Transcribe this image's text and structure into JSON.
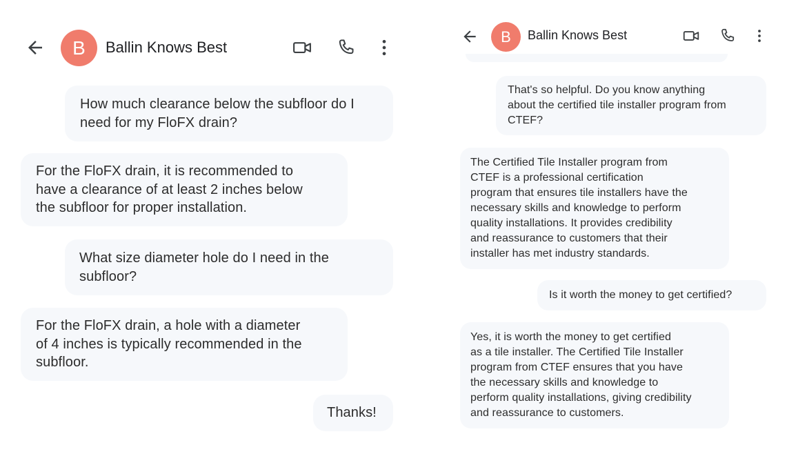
{
  "colors": {
    "avatar_bg": "#f07c6c",
    "bubble_bg": "#f6f8fb",
    "icon": "#3c4043"
  },
  "icons": {
    "back": "arrow-left-icon",
    "video": "video-camera-icon",
    "phone": "phone-icon",
    "more": "more-vertical-icon"
  },
  "left_screen": {
    "header": {
      "contact_name": "Ballin Knows Best",
      "avatar_initial": "B"
    },
    "messages": [
      {
        "sender": "user",
        "text": "How much clearance below the subfloor do I\nneed for my FloFX drain?"
      },
      {
        "sender": "bot",
        "text": "For the FloFX drain, it is recommended to\nhave a clearance of at least 2 inches below\nthe subfloor for proper installation."
      },
      {
        "sender": "user",
        "text": "What size diameter hole do I need in the\nsubfloor?"
      },
      {
        "sender": "bot",
        "text": "For the FloFX drain, a hole with a diameter\nof 4 inches is typically recommended in the\nsubfloor."
      },
      {
        "sender": "user",
        "text": "Thanks!"
      }
    ]
  },
  "right_screen": {
    "header": {
      "contact_name": "Ballin Knows Best",
      "avatar_initial": "B"
    },
    "messages": [
      {
        "sender": "user",
        "text": "That's so helpful. Do you know anything\nabout the certified tile installer program from\nCTEF?"
      },
      {
        "sender": "bot",
        "text": "The Certified Tile Installer program from\nCTEF is a professional certification\nprogram that ensures tile installers have the\nnecessary skills and knowledge to perform\nquality installations. It provides credibility\nand reassurance to customers that their\ninstaller has met industry standards."
      },
      {
        "sender": "user",
        "text": "Is it worth the money to get certified?"
      },
      {
        "sender": "bot",
        "text": "Yes, it is worth the money to get certified\nas a tile installer. The Certified Tile Installer\nprogram from CTEF ensures that you have\nthe necessary skills and knowledge to\nperform quality installations, giving credibility\nand reassurance to customers."
      }
    ]
  }
}
